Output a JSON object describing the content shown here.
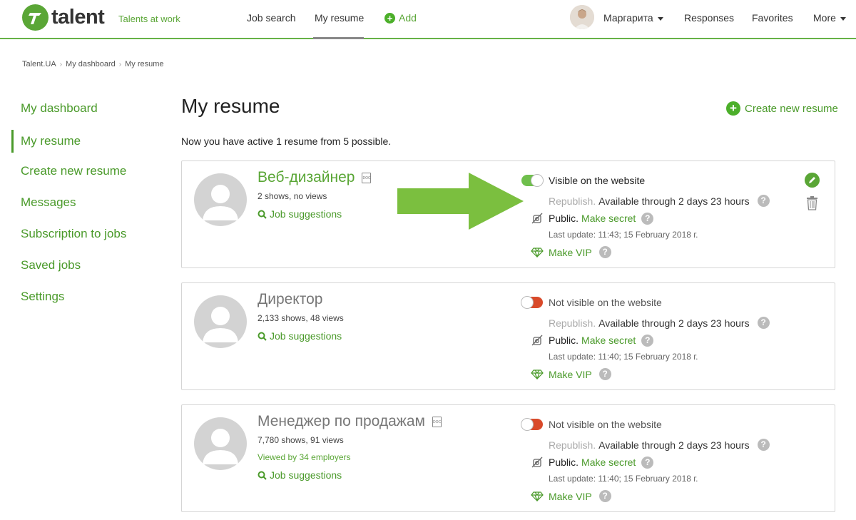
{
  "header": {
    "logo_text": "talent",
    "tagline": "Talents at work",
    "nav": {
      "job_search": "Job search",
      "my_resume": "My resume",
      "add": "Add",
      "user_name": "Маргарита",
      "responses": "Responses",
      "favorites": "Favorites",
      "more": "More"
    }
  },
  "breadcrumb": [
    "Talent.UA",
    "My dashboard",
    "My resume"
  ],
  "sidebar": {
    "items": [
      {
        "label": "My dashboard"
      },
      {
        "label": "My resume"
      },
      {
        "label": "Create new resume"
      },
      {
        "label": "Messages"
      },
      {
        "label": "Subscription to jobs"
      },
      {
        "label": "Saved jobs"
      },
      {
        "label": "Settings"
      }
    ],
    "active_index": 1
  },
  "main": {
    "title": "My resume",
    "create_label": "Create new resume",
    "summary": "Now you have active 1 resume from 5 possible.",
    "resumes": [
      {
        "title": "Веб-дизайнер",
        "doc_label": "DOC",
        "stats": "2 shows, no views",
        "viewed": "",
        "job_suggestions": "Job suggestions",
        "visibility": "Visible on the website",
        "visible": true,
        "republish": "Republish.",
        "available": "Available through 2 days 23 hours",
        "public": "Public.",
        "make_secret": "Make secret",
        "last_update": "Last update: 11:43; 15 February 2018 г.",
        "make_vip": "Make VIP",
        "help": "?"
      },
      {
        "title": "Директор",
        "doc_label": "",
        "stats": "2,133 shows, 48 views",
        "viewed": "",
        "job_suggestions": "Job suggestions",
        "visibility": "Not visible on the website",
        "visible": false,
        "republish": "Republish.",
        "available": "Available through 2 days 23 hours",
        "public": "Public.",
        "make_secret": "Make secret",
        "last_update": "Last update: 11:40; 15 February 2018 г.",
        "make_vip": "Make VIP",
        "help": "?"
      },
      {
        "title": "Менеджер по продажам",
        "doc_label": "DOC",
        "stats": "7,780 shows, 91 views",
        "viewed": "Viewed by 34 employers",
        "job_suggestions": "Job suggestions",
        "visibility": "Not visible on the website",
        "visible": false,
        "republish": "Republish.",
        "available": "Available through 2 days 23 hours",
        "public": "Public.",
        "make_secret": "Make secret",
        "last_update": "Last update: 11:40; 15 February 2018 г.",
        "make_vip": "Make VIP",
        "help": "?"
      }
    ]
  },
  "colors": {
    "brand_green": "#5aa636",
    "toggle_off": "#d94a2a",
    "arrow_green": "#7bbf3f"
  }
}
